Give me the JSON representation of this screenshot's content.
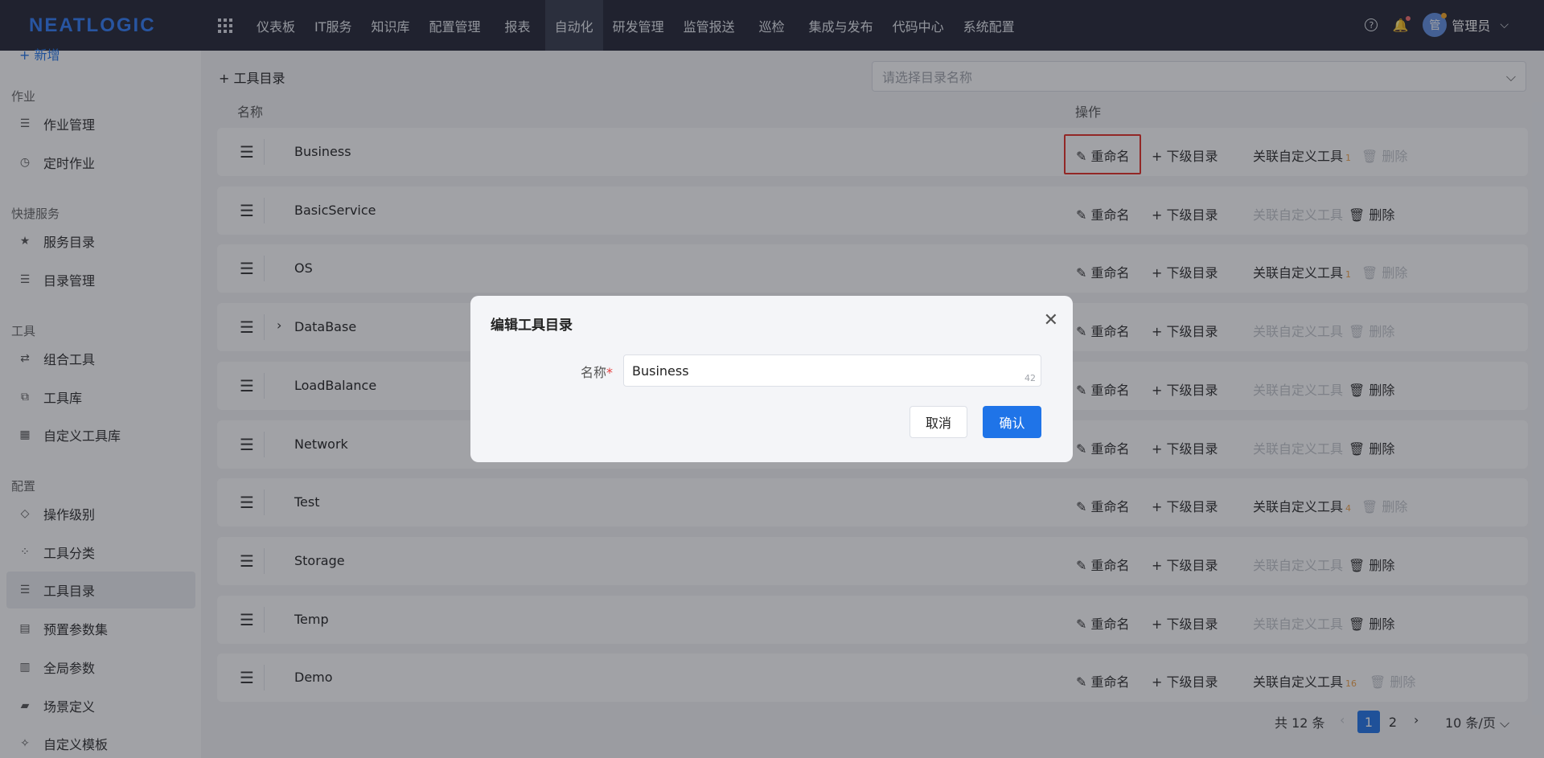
{
  "nav": {
    "logo": "NEATLOGIC",
    "menu": [
      "仪表板",
      "IT服务",
      "知识库",
      "配置管理",
      "报表",
      "自动化",
      "研发管理",
      "监管报送",
      "巡检",
      "集成与发布",
      "代码中心",
      "系统配置"
    ],
    "active_menu": "自动化",
    "help_icon": "?",
    "avatar_text": "管",
    "user_name": "管理员"
  },
  "sidebar": {
    "new_label": "新增",
    "groups": [
      {
        "label": "作业",
        "items": [
          {
            "label": "作业管理",
            "icon": "list-clock-icon"
          },
          {
            "label": "定时作业",
            "icon": "clock-icon"
          }
        ]
      },
      {
        "label": "快捷服务",
        "items": [
          {
            "label": "服务目录",
            "icon": "star-icon"
          },
          {
            "label": "目录管理",
            "icon": "list-icon"
          }
        ]
      },
      {
        "label": "工具",
        "items": [
          {
            "label": "组合工具",
            "icon": "flow-icon"
          },
          {
            "label": "工具库",
            "icon": "copy-icon"
          },
          {
            "label": "自定义工具库",
            "icon": "calendar-icon"
          }
        ]
      },
      {
        "label": "配置",
        "items": [
          {
            "label": "操作级别",
            "icon": "diamond-icon"
          },
          {
            "label": "工具分类",
            "icon": "grid-icon"
          },
          {
            "label": "工具目录",
            "icon": "list-icon"
          },
          {
            "label": "预置参数集",
            "icon": "file-icon"
          },
          {
            "label": "全局参数",
            "icon": "chart-icon"
          },
          {
            "label": "场景定义",
            "icon": "clapper-icon"
          },
          {
            "label": "自定义模板",
            "icon": "puzzle-icon"
          }
        ]
      }
    ],
    "active_item": "工具目录"
  },
  "toolbar": {
    "add_label": "+ 工具目录",
    "select_placeholder": "请选择目录名称"
  },
  "table": {
    "col_name": "名称",
    "col_ops": "操作",
    "rename": "重命名",
    "add_sub": "+ 下级目录",
    "link_tool": "关联自定义工具",
    "delete": "删除",
    "rows": [
      {
        "name": "Business",
        "count": "1",
        "link_enabled": true,
        "delete_enabled": false,
        "expandable": false
      },
      {
        "name": "BasicService",
        "count": "",
        "link_enabled": false,
        "delete_enabled": true,
        "expandable": false
      },
      {
        "name": "OS",
        "count": "1",
        "link_enabled": true,
        "delete_enabled": false,
        "expandable": false
      },
      {
        "name": "DataBase",
        "count": "",
        "link_enabled": false,
        "delete_enabled": false,
        "expandable": true
      },
      {
        "name": "LoadBalance",
        "count": "",
        "link_enabled": false,
        "delete_enabled": true,
        "expandable": false
      },
      {
        "name": "Network",
        "count": "",
        "link_enabled": false,
        "delete_enabled": true,
        "expandable": false
      },
      {
        "name": "Test",
        "count": "4",
        "link_enabled": true,
        "delete_enabled": false,
        "expandable": false
      },
      {
        "name": "Storage",
        "count": "",
        "link_enabled": false,
        "delete_enabled": true,
        "expandable": false
      },
      {
        "name": "Temp",
        "count": "",
        "link_enabled": false,
        "delete_enabled": true,
        "expandable": false
      },
      {
        "name": "Demo",
        "count": "16",
        "link_enabled": true,
        "delete_enabled": false,
        "expandable": false
      }
    ]
  },
  "pagination": {
    "total": "共 12 条",
    "pages": [
      "1",
      "2"
    ],
    "current": "1",
    "page_size": "10 条/页"
  },
  "dialog": {
    "title": "编辑工具目录",
    "label": "名称",
    "required_mark": "*",
    "value": "Business",
    "remaining": "42",
    "cancel": "取消",
    "confirm": "确认"
  },
  "colors": {
    "primary": "#1f74e8",
    "nav_bg": "#212432",
    "highlight": "#e52b24",
    "count": "#f0a24a"
  }
}
